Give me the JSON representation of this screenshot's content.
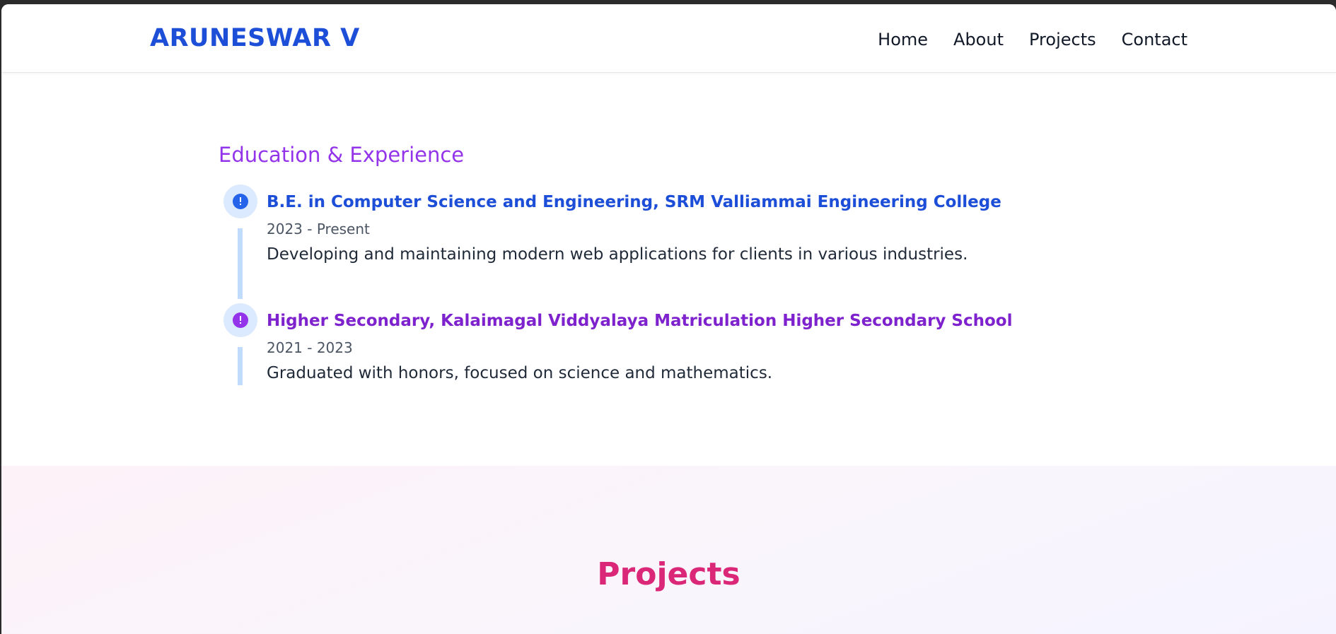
{
  "nav": {
    "brand": "ARUNESWAR V",
    "links": [
      "Home",
      "About",
      "Projects",
      "Contact"
    ]
  },
  "education": {
    "title": "Education & Experience",
    "items": [
      {
        "title": "B.E. in Computer Science and Engineering, SRM Valliammai Engineering College",
        "date": "2023 - Present",
        "description": "Developing and maintaining modern web applications for clients in various industries.",
        "color": "#1d4ed8"
      },
      {
        "title": "Higher Secondary, Kalaimagal Viddyalaya Matriculation Higher Secondary School",
        "date": "2021 - 2023",
        "description": "Graduated with honors, focused on science and mathematics.",
        "color": "#7e22ce"
      }
    ]
  },
  "projects": {
    "title": "Projects",
    "card_colors": [
      "#ec4899",
      "#a855f7",
      "#3b82f6"
    ]
  },
  "icons": {
    "timeline_marker": "info-circle-icon"
  }
}
